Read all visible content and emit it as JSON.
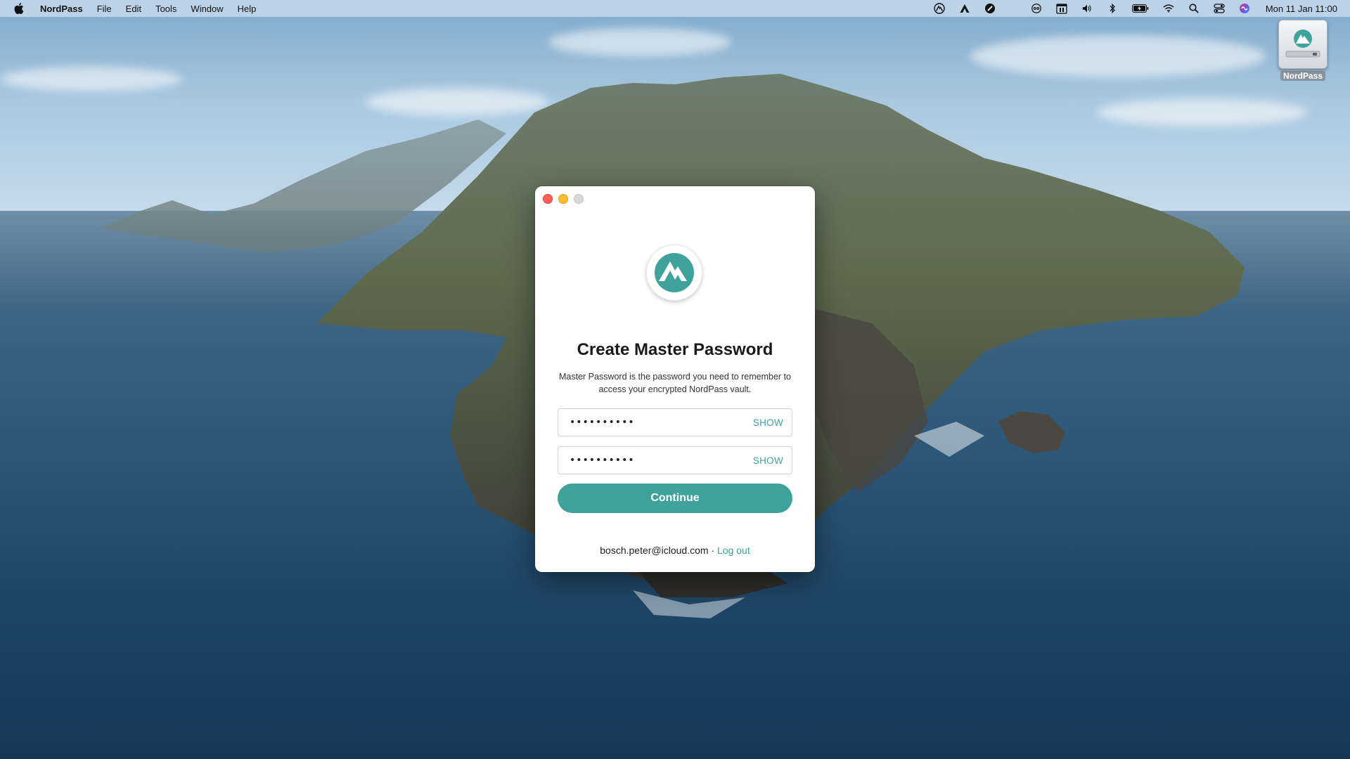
{
  "menubar": {
    "app_name": "NordPass",
    "menus": [
      "File",
      "Edit",
      "Tools",
      "Window",
      "Help"
    ],
    "status_icons": [
      "nordvpn-icon",
      "nordlayer-icon",
      "app-icon",
      "accessibility-icon",
      "calendar-icon",
      "volume-icon",
      "bluetooth-icon",
      "battery-icon",
      "wifi-icon",
      "spotlight-icon",
      "control-center-icon",
      "siri-icon"
    ],
    "clock": "Mon 11 Jan  11:00"
  },
  "desktop": {
    "disk_label": "NordPass"
  },
  "window": {
    "title": "Create Master Password",
    "description": "Master Password is the password you need to remember to access your encrypted NordPass vault.",
    "password_field": {
      "value": "••••••••••",
      "show_label": "SHOW"
    },
    "confirm_field": {
      "value": "••••••••••",
      "show_label": "SHOW"
    },
    "continue_label": "Continue",
    "account_email": "bosch.peter@icloud.com",
    "separator": "·",
    "logout_label": "Log out"
  },
  "colors": {
    "accent": "#3fa39b",
    "link": "#3ba39d",
    "traffic_close": "#fe5f57",
    "traffic_min": "#febc2e",
    "traffic_zoom": "#d9d9d9"
  }
}
